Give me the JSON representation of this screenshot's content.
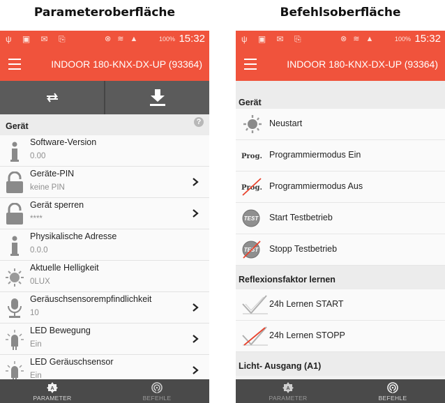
{
  "headings": {
    "left": "Parameteroberfläche",
    "right": "Befehlsoberfläche"
  },
  "statusbar": {
    "left_icons": "ψ ▣ ✉ ⎘",
    "mid_icons": "⊗ ≋ ▲",
    "battery": "100%",
    "time": "15:32"
  },
  "app": {
    "title": "INDOOR 180-KNX-DX-UP (93364)"
  },
  "toolbar": {
    "sync_icon": "sync-icon",
    "download_icon": "download-icon"
  },
  "params": {
    "section": "Gerät",
    "items": [
      {
        "name": "Software-Version",
        "value": "0.00",
        "icon": "info-icon",
        "chevron": false
      },
      {
        "name": "Geräte-PIN",
        "value": "keine PIN",
        "icon": "lock-icon",
        "chevron": true
      },
      {
        "name": "Gerät sperren",
        "value": "****",
        "icon": "lock-icon",
        "chevron": true
      },
      {
        "name": "Physikalische Adresse",
        "value": "0.0.0",
        "icon": "info-icon",
        "chevron": false
      },
      {
        "name": "Aktuelle Helligkeit",
        "value": "0LUX",
        "icon": "brightness-icon",
        "chevron": false
      },
      {
        "name": "Geräuschsensorempfindlichkeit",
        "value": "10",
        "icon": "microphone-icon",
        "chevron": true
      },
      {
        "name": "LED Bewegung",
        "value": "Ein",
        "icon": "led-icon",
        "chevron": true
      },
      {
        "name": "LED Geräuschsensor",
        "value": "Ein",
        "icon": "led-icon",
        "chevron": true
      }
    ]
  },
  "commands": {
    "section_device": "Gerät",
    "device_items": [
      {
        "name": "Neustart",
        "icon": "restart-icon"
      },
      {
        "name": "Programmiermodus Ein",
        "icon": "prog-on-icon",
        "icon_text": "Prog."
      },
      {
        "name": "Programmiermodus Aus",
        "icon": "prog-off-icon",
        "icon_text": "Prog."
      },
      {
        "name": "Start Testbetrieb",
        "icon": "test-start-icon",
        "icon_text": "TEST"
      },
      {
        "name": "Stopp Testbetrieb",
        "icon": "test-stop-icon",
        "icon_text": "TEST"
      }
    ],
    "section_reflex": "Reflexionsfaktor lernen",
    "reflex_items": [
      {
        "name": "24h Lernen START",
        "icon": "learn-start-icon"
      },
      {
        "name": "24h Lernen STOPP",
        "icon": "learn-stop-icon"
      }
    ],
    "section_light": "Licht- Ausgang (A1)"
  },
  "bottomnav": {
    "parameter": "PARAMETER",
    "befehle": "BEFEHLE",
    "active_left": "parameter",
    "active_right": "befehle"
  },
  "colors": {
    "accent": "#f0533c",
    "toolbar": "#5b5b5b",
    "nav": "#4a4a4a"
  }
}
